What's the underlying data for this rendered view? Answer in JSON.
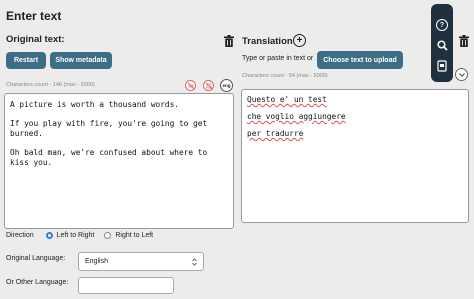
{
  "header": {
    "title": "Enter text"
  },
  "original": {
    "label": "Original text:",
    "restart_label": "Restart",
    "metadata_label": "Show metadata",
    "char_count": "Characters count - 146 (max - 5000)",
    "lang_badge": "eng",
    "lines": [
      "A picture is worth a thousand words.",
      "If you play with fire, you're going to get burned.",
      "Oh bald man, we're confused about where to kiss you."
    ]
  },
  "direction": {
    "label": "Direction",
    "ltr": "Left to Right",
    "rtl": "Right to Left",
    "selected": "Left to Right"
  },
  "language": {
    "original_label": "Original Language:",
    "original_value": "English",
    "other_label": "Or Other Language:",
    "other_value": ""
  },
  "translation": {
    "label": "Translation",
    "type_paste": "Type or paste in text or",
    "choose_label": "Choose text to upload",
    "char_count": "Characters count - 54 (max - 5000)",
    "lines": [
      "Questo e' un test",
      "che voglio aggiungere",
      "per tradurre"
    ]
  },
  "toolbar": {
    "help_glyph": "?"
  },
  "colors": {
    "button": "#3e6e86",
    "toolbar": "#21303e",
    "radio_selected": "#2f7cd6"
  }
}
